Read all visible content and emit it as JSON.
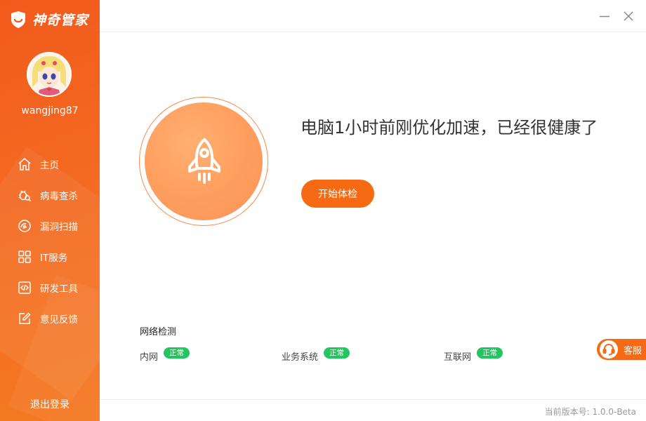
{
  "app": {
    "name": "神奇管家",
    "accent": "#f56a12"
  },
  "user": {
    "name": "wangjing87"
  },
  "sidebar": {
    "items": [
      {
        "label": "主页",
        "icon": "home-icon"
      },
      {
        "label": "病毒查杀",
        "icon": "bug-search-icon"
      },
      {
        "label": "漏洞扫描",
        "icon": "scan-icon"
      },
      {
        "label": "IT服务",
        "icon": "grid-icon"
      },
      {
        "label": "研发工具",
        "icon": "code-icon"
      },
      {
        "label": "意见反馈",
        "icon": "edit-icon"
      }
    ],
    "logout_label": "退出登录"
  },
  "main": {
    "headline": "电脑1小时前刚优化加速，已经很健康了",
    "start_button": "开始体检",
    "network": {
      "title": "网络检测",
      "items": [
        {
          "label": "内网",
          "status": "正常"
        },
        {
          "label": "业务系统",
          "status": "正常"
        },
        {
          "label": "互联网",
          "status": "正常"
        }
      ],
      "status_color": "#22c55e"
    },
    "support_label": "客服"
  },
  "footer": {
    "version": "当前版本号: 1.0.0-Beta"
  }
}
